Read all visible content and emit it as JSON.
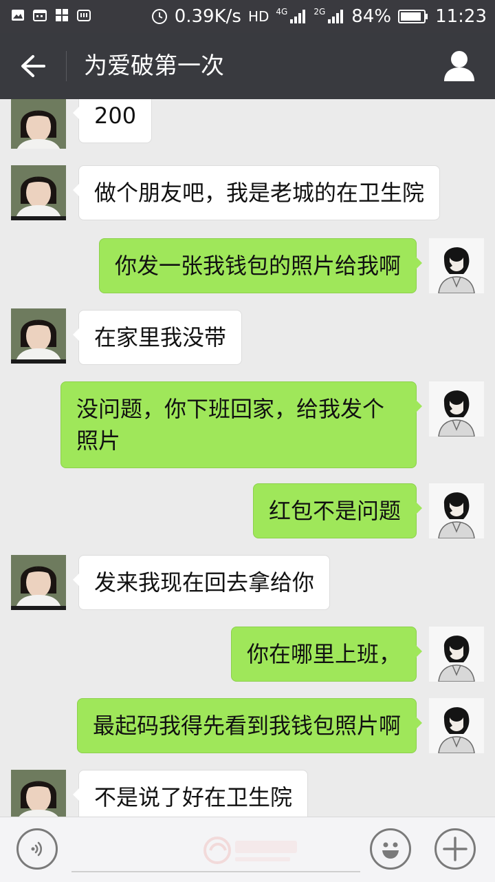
{
  "status_bar": {
    "speed": "0.39K/s",
    "hd": "HD",
    "sim1_label": "4G",
    "sim2_label": "2G",
    "battery": "84%",
    "time": "11:23"
  },
  "header": {
    "title": "为爱破第一次"
  },
  "messages": [
    {
      "side": "left",
      "text": "200"
    },
    {
      "side": "left",
      "text": "做个朋友吧，我是老城的在卫生院"
    },
    {
      "side": "right",
      "text": "你发一张我钱包的照片给我啊"
    },
    {
      "side": "left",
      "text": "在家里我没带"
    },
    {
      "side": "right",
      "text": "没问题，你下班回家，给我发个照片"
    },
    {
      "side": "right",
      "text": "红包不是问题"
    },
    {
      "side": "left",
      "text": "发来我现在回去拿给你"
    },
    {
      "side": "right",
      "text": "你在哪里上班，"
    },
    {
      "side": "right",
      "text": "最起码我得先看到我钱包照片啊"
    },
    {
      "side": "left",
      "text": "不是说了好在卫生院"
    }
  ],
  "input": {
    "value": ""
  },
  "colors": {
    "bar": "#393a3f",
    "chat_bg": "#ebebeb",
    "bubble_sent": "#9fe75a",
    "bubble_received": "#ffffff"
  },
  "icons": {
    "back": "back-arrow-icon",
    "profile": "person-icon",
    "voice": "voice-icon",
    "emoji": "emoji-icon",
    "plus": "plus-icon"
  }
}
